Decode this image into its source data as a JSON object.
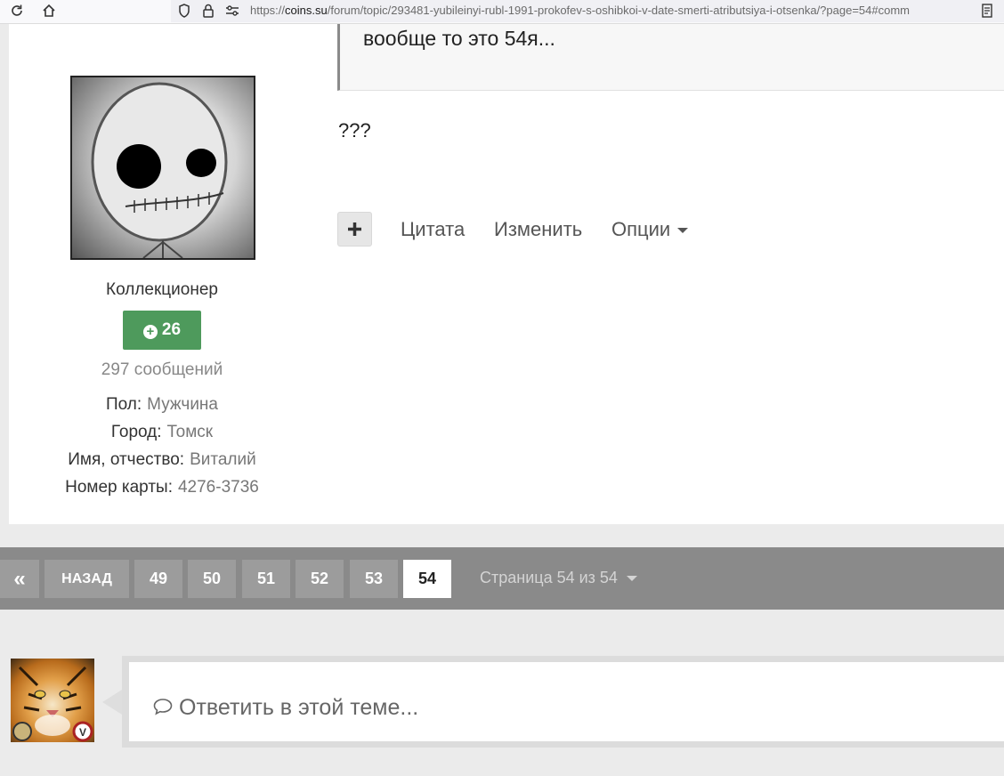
{
  "browser": {
    "url_prefix": "https://",
    "url_domain": "coins.su",
    "url_path": "/forum/topic/293481-yubileinyi-rubl-1991-prokofev-s-oshibkoi-v-date-smerti-atributsiya-i-otsenka/?page=54#comm",
    "icons": [
      "reload-icon",
      "home-icon",
      "shield-icon",
      "lock-icon",
      "permissions-icon",
      "reader-mode-icon"
    ]
  },
  "post": {
    "quote_text": "вообще то это 54я...",
    "body_text": "???",
    "actions": {
      "quote": "Цитата",
      "edit": "Изменить",
      "options": "Опции"
    }
  },
  "author": {
    "rank": "Коллекционер",
    "reputation": "26",
    "post_count": "297 сообщений",
    "fields": [
      {
        "label": "Пол:",
        "value": "Мужчина"
      },
      {
        "label": "Город:",
        "value": "Томск"
      },
      {
        "label": "Имя, отчество:",
        "value": "Виталий"
      },
      {
        "label": "Номер карты:",
        "value": "4276-3736"
      }
    ]
  },
  "pagination": {
    "first_icon": "«",
    "back_label": "НАЗАД",
    "pages": [
      "49",
      "50",
      "51",
      "52",
      "53",
      "54"
    ],
    "current_page": "54",
    "info": "Страница 54 из 54"
  },
  "reply": {
    "placeholder": "Ответить в этой теме..."
  },
  "colors": {
    "reputation_green": "#4e9a5c",
    "pagination_bg": "#8a8a8a"
  }
}
